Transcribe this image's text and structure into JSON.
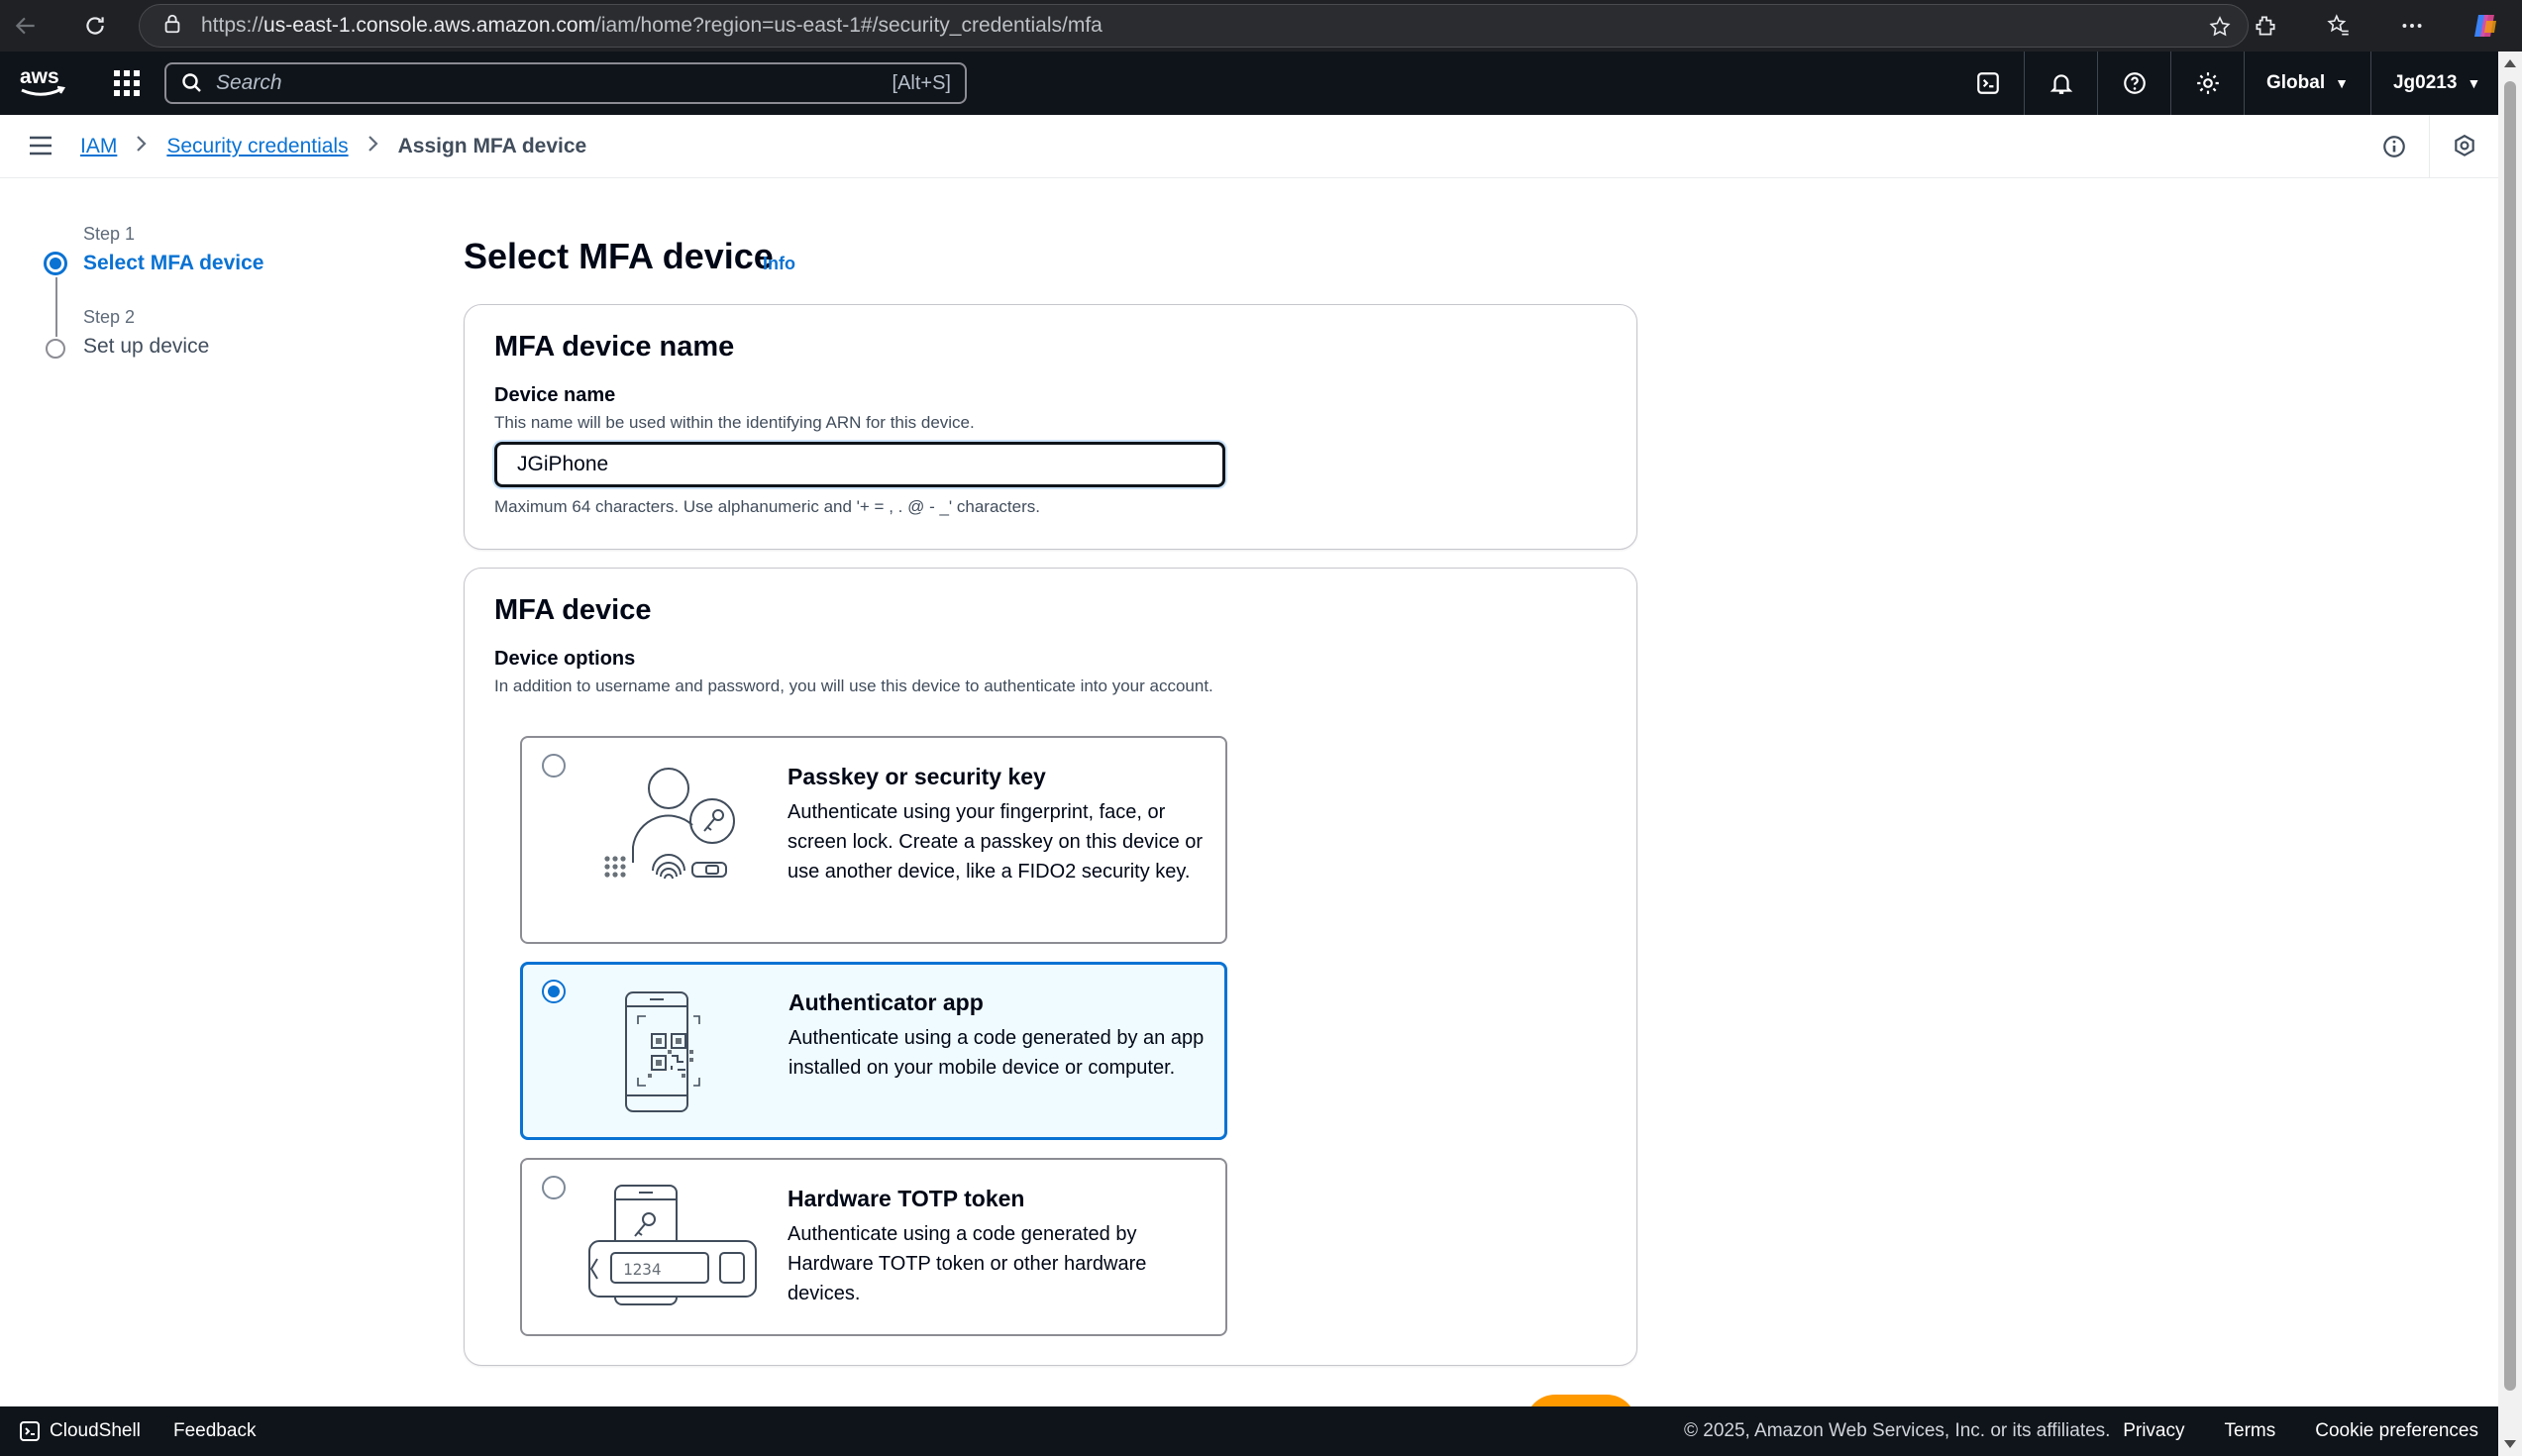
{
  "browser": {
    "url_prefix": "https://",
    "url_host": "us-east-1.console.aws.amazon.com",
    "url_path": "/iam/home?region=us-east-1#/security_credentials/mfa"
  },
  "topnav": {
    "search_placeholder": "Search",
    "search_shortcut": "[Alt+S]",
    "region": "Global",
    "account": "Jg0213"
  },
  "breadcrumb": {
    "items": [
      "IAM",
      "Security credentials"
    ],
    "current": "Assign MFA device"
  },
  "steps": [
    {
      "label": "Step 1",
      "title": "Select MFA device"
    },
    {
      "label": "Step 2",
      "title": "Set up device"
    }
  ],
  "page": {
    "title": "Select MFA device",
    "info": "Info"
  },
  "name_panel": {
    "heading": "MFA device name",
    "field_label": "Device name",
    "field_desc": "This name will be used within the identifying ARN for this device.",
    "value": "JGiPhone",
    "constraint": "Maximum 64 characters. Use alphanumeric and '+ = , . @ - _' characters."
  },
  "device_panel": {
    "heading": "MFA device",
    "field_label": "Device options",
    "field_desc": "In addition to username and password, you will use this device to authenticate into your account.",
    "options": [
      {
        "title": "Passkey or security key",
        "desc": "Authenticate using your fingerprint, face, or screen lock. Create a passkey on this device or use another device, like a FIDO2 security key.",
        "selected": false
      },
      {
        "title": "Authenticator app",
        "desc": "Authenticate using a code generated by an app installed on your mobile device or computer.",
        "selected": true
      },
      {
        "title": "Hardware TOTP token",
        "desc": "Authenticate using a code generated by Hardware TOTP token or other hardware devices.",
        "selected": false
      }
    ],
    "token_display": "1234"
  },
  "footer": {
    "cloudshell": "CloudShell",
    "feedback": "Feedback",
    "copyright": "© 2025, Amazon Web Services, Inc. or its affiliates.",
    "links": [
      "Privacy",
      "Terms",
      "Cookie preferences"
    ]
  },
  "colors": {
    "accent": "#0972d3",
    "nav_bg": "#0f141a",
    "primary_button": "#ff9900",
    "selected_tile_bg": "#f0fbff"
  }
}
